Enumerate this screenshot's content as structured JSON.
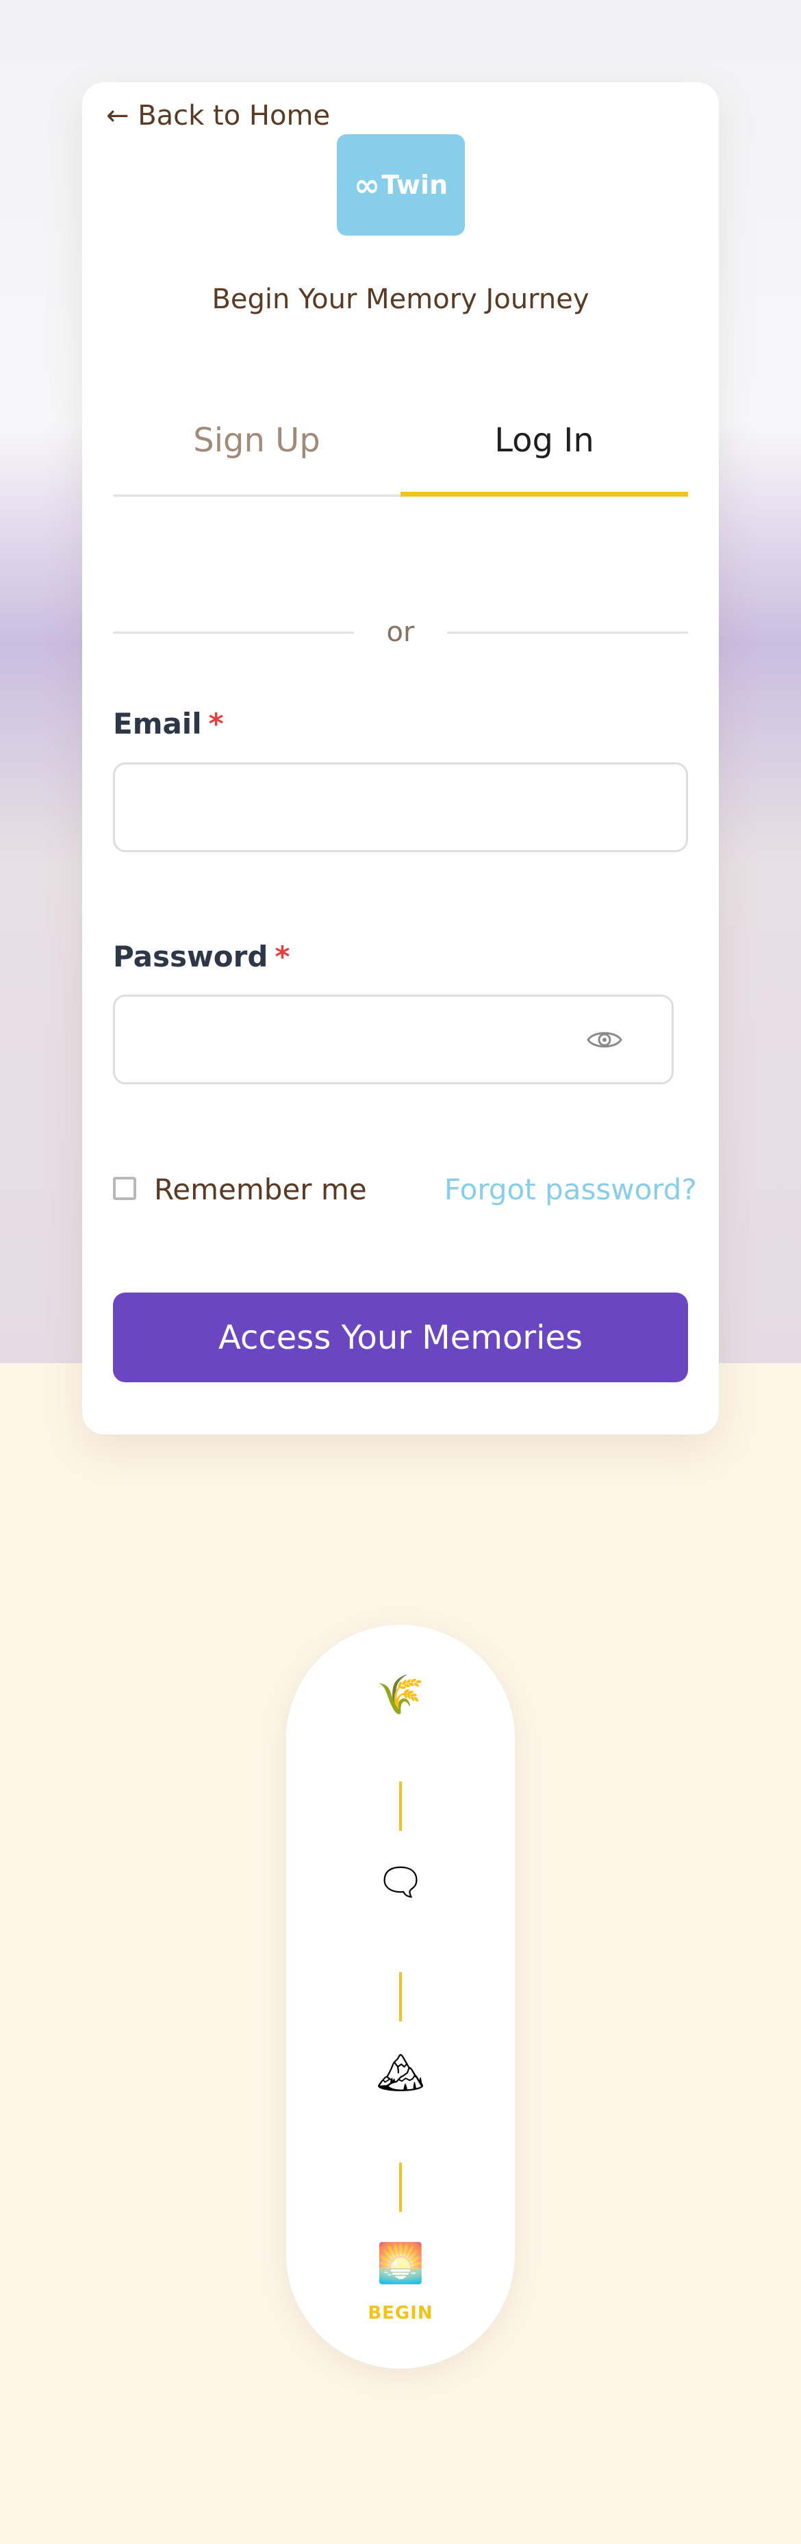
{
  "nav": {
    "back_label": "← Back to Home"
  },
  "logo": {
    "symbol": "∞",
    "text": "Twin",
    "color": "#87ceeb"
  },
  "tagline": "Begin Your Memory Journey",
  "tabs": [
    {
      "label": "Sign Up",
      "active": false
    },
    {
      "label": "Log In",
      "active": true
    }
  ],
  "divider_text": "or",
  "form": {
    "email": {
      "label": "Email",
      "required_mark": "*",
      "value": "",
      "placeholder": ""
    },
    "password": {
      "label": "Password",
      "required_mark": "*",
      "value": "",
      "placeholder": "",
      "toggle_icon": "eye-icon"
    },
    "remember_label": "Remember me",
    "remember_checked": false,
    "forgot_label": "Forgot password?",
    "submit_label": "Access Your Memories"
  },
  "timeline": {
    "steps": [
      {
        "icon": "wheat-icon",
        "glyph": "🌾"
      },
      {
        "icon": "speech-bubble-icon",
        "glyph": "🗨"
      },
      {
        "icon": "mountain-icon",
        "glyph": "🏔"
      },
      {
        "icon": "sunrise-icon",
        "glyph": "🌅"
      }
    ],
    "begin_label": "BEGIN"
  },
  "colors": {
    "accent_yellow": "#f2c318",
    "primary_purple": "#6b46c1",
    "link_blue": "#87ceeb",
    "brown_text": "#5a3a22",
    "required_red": "#e53e3e"
  }
}
